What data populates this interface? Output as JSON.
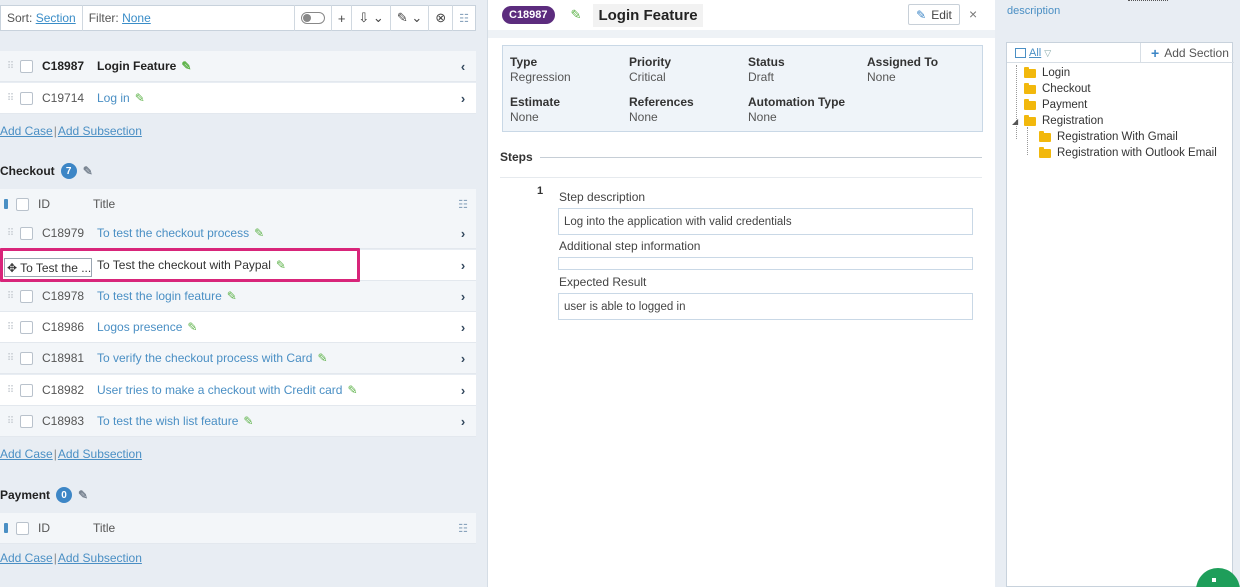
{
  "toolbar": {
    "sort_label": "Sort:",
    "sort_value": "Section",
    "filter_label": "Filter:",
    "filter_value": "None",
    "icons": [
      "toggle-icon",
      "plus-icon",
      "assign-icon",
      "edit-icon",
      "close-circle-icon",
      "columns-icon"
    ]
  },
  "top_rows": [
    {
      "id": "C18987",
      "title": "Login Feature",
      "selected": true
    },
    {
      "id": "C19714",
      "title": "Log in",
      "selected": false
    }
  ],
  "add_links": {
    "add_case": "Add Case",
    "sep": "|",
    "add_subsection": "Add Subsection"
  },
  "checkout": {
    "title": "Checkout",
    "count": "7",
    "header": {
      "id": "ID",
      "title": "Title"
    },
    "rows": [
      {
        "id": "C18979",
        "title": "To test the checkout process"
      },
      {
        "id": "",
        "title": "To Test the checkout with Paypal"
      },
      {
        "id": "C18978",
        "title": "To test the login feature"
      },
      {
        "id": "C18986",
        "title": "Logos presence"
      },
      {
        "id": "C18981",
        "title": "To verify the checkout process with Card"
      },
      {
        "id": "C18982",
        "title": "User tries to make a checkout with Credit card"
      },
      {
        "id": "C18983",
        "title": "To test the wish list feature"
      }
    ],
    "drag_ghost": "To Test the ..."
  },
  "payment": {
    "title": "Payment",
    "count": "0",
    "header": {
      "id": "ID",
      "title": "Title"
    }
  },
  "detail": {
    "case_id": "C18987",
    "title": "Login Feature",
    "edit_label": "Edit",
    "close": "×",
    "props": [
      {
        "key": "Type",
        "value": "Regression"
      },
      {
        "key": "Priority",
        "value": "Critical"
      },
      {
        "key": "Status",
        "value": "Draft"
      },
      {
        "key": "Assigned To",
        "value": "None"
      },
      {
        "key": "Estimate",
        "value": "None"
      },
      {
        "key": "References",
        "value": "None"
      },
      {
        "key": "Automation Type",
        "value": "None"
      }
    ],
    "steps_label": "Steps",
    "step": {
      "number": "1",
      "desc_label": "Step description",
      "desc_value": "Log into the application with valid credentials",
      "info_label": "Additional step information",
      "info_value": "",
      "expected_label": "Expected Result",
      "expected_value": "user is able to logged in"
    }
  },
  "right": {
    "description": "description",
    "all_label": "All",
    "add_section": "Add Section",
    "tree": [
      "Login",
      "Checkout",
      "Payment",
      "Registration",
      "Registration With Gmail",
      "Registration with Outlook Email"
    ]
  },
  "colors": {
    "accent": "#4a8fc4",
    "case_pill": "#5c2c7e",
    "highlight": "#d8257a",
    "folder": "#f2b80c"
  }
}
